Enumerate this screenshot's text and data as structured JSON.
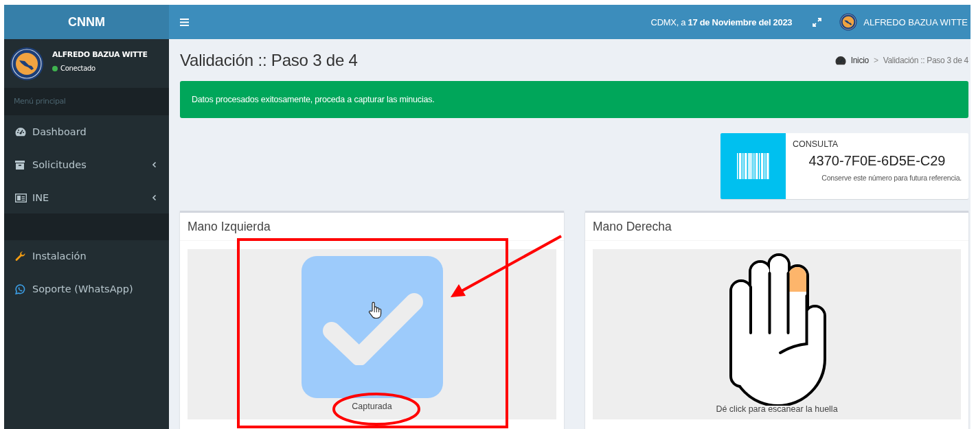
{
  "header": {
    "brand": "CNNM",
    "date": "CDMX, a **17 de Noviembre del 2023**",
    "user": "ALFREDO BAZUA WITTE"
  },
  "sidebar": {
    "user": {
      "name": "ALFREDO BAZUA WITTE",
      "status": "Conectado"
    },
    "section": "Menú principal",
    "items": [
      {
        "label": "Dashboard",
        "has_submenu": false
      },
      {
        "label": "Solicitudes",
        "has_submenu": true
      },
      {
        "label": "INE",
        "has_submenu": true
      },
      {
        "kind": "blank"
      },
      {
        "label": "Instalación",
        "has_submenu": false
      },
      {
        "label": "Soporte (WhatsApp)",
        "has_submenu": false
      }
    ]
  },
  "page": {
    "title": "Validación :: Paso 3 de 4",
    "breadcrumb": {
      "separator": ">",
      "items": [
        "Inicio",
        "Validación :: Paso 3 de 4"
      ]
    },
    "alert": "Datos procesados exitosamente, proceda a capturar las minucias.",
    "info_box": {
      "label": "CONSULTA",
      "number": "4370-7F0E-6D5E-C29",
      "note": "Conserve este número para futura referencia."
    },
    "cards": [
      {
        "title": "Mano Izquierda",
        "kind": "captured",
        "caption": "Capturada"
      },
      {
        "title": "Mano Derecha",
        "kind": "pending",
        "caption": "Dé click para escanear la huella",
        "fingers": [
          {
            "selected": false
          },
          {
            "selected": false
          },
          {
            "selected": false
          },
          {
            "selected": true
          },
          {
            "selected": false
          }
        ]
      }
    ]
  },
  "annotations": [
    {
      "kind": "rectangle"
    },
    {
      "kind": "ellipse"
    },
    {
      "kind": "arrow"
    }
  ]
}
